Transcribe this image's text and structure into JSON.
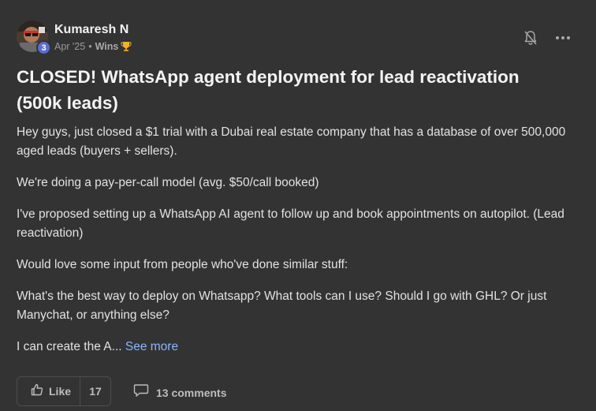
{
  "post": {
    "author": {
      "name": "Kumaresh N",
      "level": "3"
    },
    "meta": {
      "date": "Apr '25",
      "separator": "•",
      "category": "Wins"
    },
    "title": "CLOSED! WhatsApp agent deployment for lead reactivation (500k leads)",
    "body": [
      "Hey guys, just closed a $1 trial with a Dubai real estate company that has a database of over 500,000 aged leads (buyers + sellers).",
      "We're doing a pay-per-call model (avg. $50/call booked)",
      "I've proposed setting up a WhatsApp AI agent to follow up and book appointments on autopilot. (Lead reactivation)",
      "Would love some input from people who've done similar stuff:",
      "What's the best way to deploy on Whatsapp? What tools can I use? Should I go with GHL? Or just Manychat, or anything else?"
    ],
    "truncated_text": "I can create the A...",
    "see_more": "See more",
    "like_label": "Like",
    "like_count": "17",
    "comments_label": "13 comments"
  },
  "icons": {
    "bell": "bell-muted-icon",
    "more": "more-horizontal-icon",
    "trophy": "trophy-icon",
    "like": "thumbs-up-icon",
    "comment": "comment-icon"
  },
  "colors": {
    "background": "#333333",
    "link": "#8ab4ff",
    "level_badge": "#5b6ccf"
  }
}
